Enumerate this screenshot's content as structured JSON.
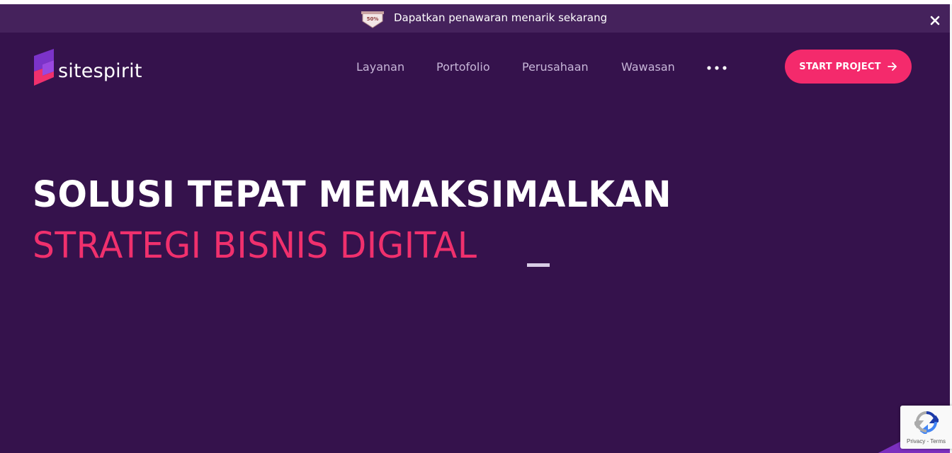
{
  "promo": {
    "text": "Dapatkan penawaran menarik sekarang",
    "badge_icon": "discount-tag-icon",
    "badge_text": "50%",
    "close_icon": "close-icon"
  },
  "header": {
    "brand": "sitespirit",
    "nav": [
      {
        "label": "Layanan"
      },
      {
        "label": "Portofolio"
      },
      {
        "label": "Perusahaan"
      },
      {
        "label": "Wawasan"
      }
    ],
    "more_icon": "more-horizontal-icon",
    "cta_label": "START PROJECT",
    "cta_icon": "arrow-right-icon"
  },
  "hero": {
    "line1": "SOLUSI TEPAT MEMAKSIMALKAN",
    "line2": "STRATEGI BISNIS DIGITAL"
  },
  "recaptcha": {
    "privacy": "Privacy",
    "separator": " - ",
    "terms": "Terms"
  },
  "colors": {
    "background": "#35124c",
    "promo_bar": "#45225c",
    "accent": "#f42a6c",
    "nav_text": "#c7b6d8"
  }
}
